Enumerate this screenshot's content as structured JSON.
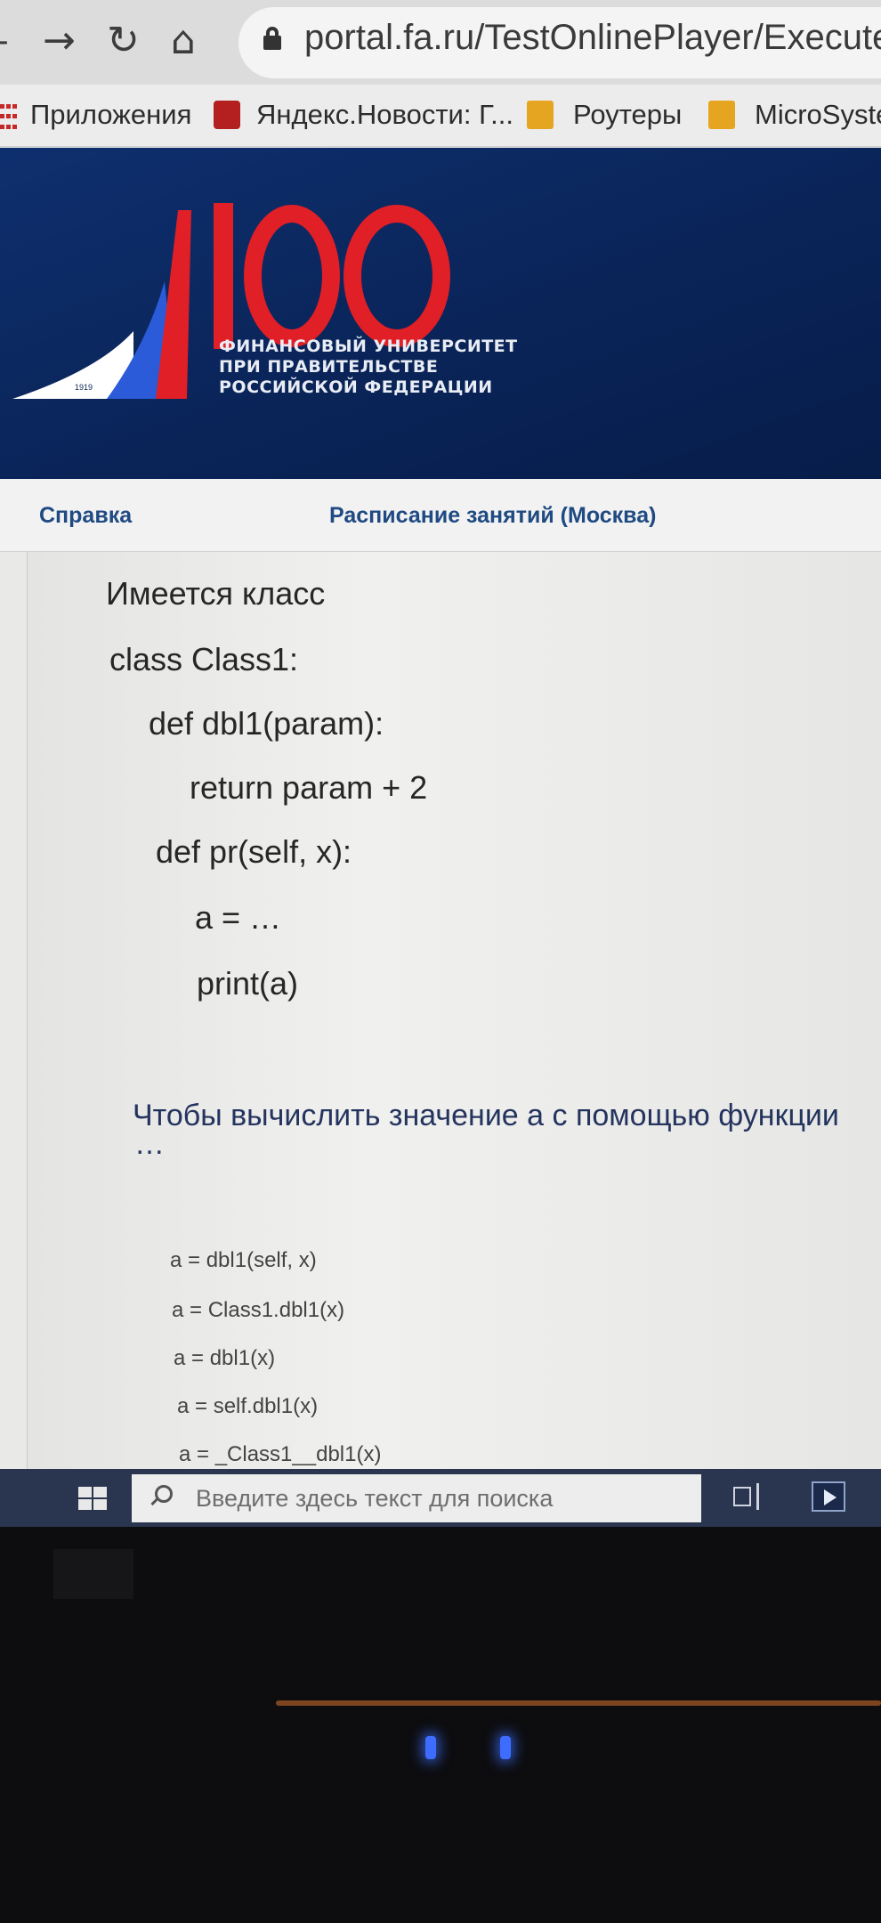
{
  "browser": {
    "url": "portal.fa.ru/TestOnlinePlayer/Execute?TestId=",
    "nav_icons": [
      "back-arrow-icon",
      "forward-arrow-icon",
      "reload-icon",
      "home-icon",
      "lock-icon"
    ]
  },
  "bookmarks": [
    {
      "label": "Приложения",
      "icon": "apps-grid-icon"
    },
    {
      "label": "Яндекс.Новости: Г...",
      "icon": "yandex-news-icon"
    },
    {
      "label": "Роутеры",
      "icon": "folder-icon"
    },
    {
      "label": "MicroSystem",
      "icon": "folder-icon"
    }
  ],
  "banner": {
    "logo_number": "100",
    "logo_year": "1919",
    "university_lines": [
      "ФИНАНСОВЫЙ УНИВЕРСИТЕТ",
      "ПРИ ПРАВИТЕЛЬСТВЕ",
      "РОССИЙСКОЙ ФЕДЕРАЦИИ"
    ],
    "colors": {
      "navy": "#0a2458",
      "red": "#e11f26",
      "blue": "#2b5bd9",
      "white": "#ffffff"
    }
  },
  "nav": {
    "help": "Справка",
    "schedule": "Расписание занятий (Москва)"
  },
  "question": {
    "intro": "Имеется класс",
    "code": [
      "class Class1:",
      "def dbl1(param):",
      "return param + 2",
      "def pr(self, x):",
      "a = …",
      "print(a)"
    ],
    "prompt_line1": "Чтобы вычислить значение a с помощью функции",
    "prompt_line2": "…",
    "options": [
      "a = dbl1(self, x)",
      "a = Class1.dbl1(x)",
      "a = dbl1(x)",
      "a = self.dbl1(x)",
      "a = _Class1__dbl1(x)"
    ]
  },
  "taskbar": {
    "search_placeholder": "Введите здесь текст для поиска",
    "icons": [
      "windows-start-icon",
      "search-icon",
      "task-view-icon",
      "media-player-icon"
    ]
  }
}
